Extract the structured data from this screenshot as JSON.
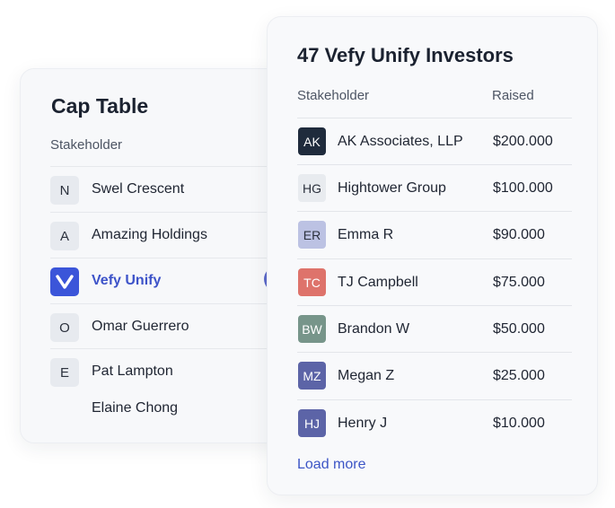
{
  "cap_table": {
    "title": "Cap Table",
    "column_header": "Stakeholder",
    "rows": [
      {
        "initial": "N",
        "name": "Swel Crescent"
      },
      {
        "initial": "A",
        "name": "Amazing Holdings"
      },
      {
        "initial": "",
        "name": "Vefy Unify",
        "selected": true
      },
      {
        "initial": "O",
        "name": "Omar Guerrero"
      },
      {
        "initial": "E",
        "name": "Pat Lampton"
      }
    ],
    "trailing_name": "Elaine Chong"
  },
  "investors": {
    "title": "47 Vefy Unify Investors",
    "col_stakeholder": "Stakeholder",
    "col_raised": "Raised",
    "rows": [
      {
        "initials": "AK",
        "name": "AK Associates, LLP",
        "raised": "$200.000",
        "color": "#1f2b3c"
      },
      {
        "initials": "HG",
        "name": "Hightower Group",
        "raised": "$100.000",
        "color": "#e8ebef"
      },
      {
        "initials": "ER",
        "name": "Emma R",
        "raised": "$90.000",
        "color": "#bcc2e3"
      },
      {
        "initials": "TC",
        "name": "TJ Campbell",
        "raised": "$75.000",
        "color": "#de736b"
      },
      {
        "initials": "BW",
        "name": "Brandon W",
        "raised": "$50.000",
        "color": "#77958a"
      },
      {
        "initials": "MZ",
        "name": "Megan Z",
        "raised": "$25.000",
        "color": "#5c64a7"
      },
      {
        "initials": "HJ",
        "name": "Henry J",
        "raised": "$10.000",
        "color": "#5c64a7"
      }
    ],
    "load_more": "Load more"
  },
  "icons": {
    "brand": "vefy-logo-icon",
    "chevron": "chevron-right-icon"
  },
  "colors": {
    "accent": "#3b55d9",
    "link": "#3c55c6"
  }
}
